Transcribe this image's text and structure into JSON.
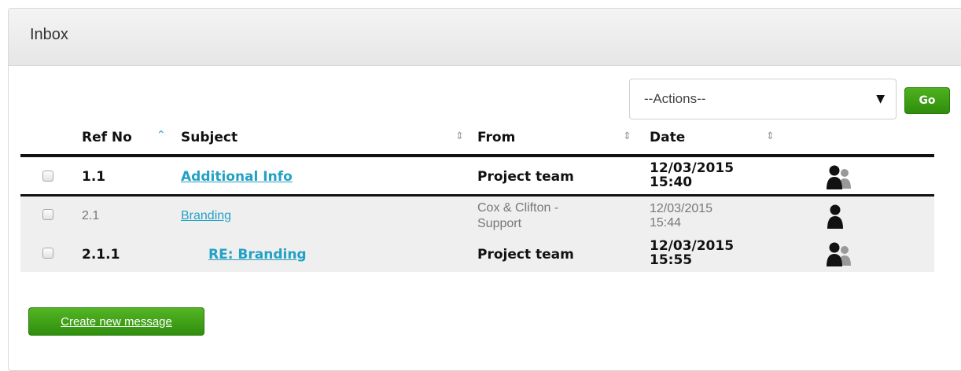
{
  "panel": {
    "title": "Inbox"
  },
  "actions": {
    "selected": "--Actions--",
    "go_label": "Go"
  },
  "table": {
    "columns": [
      {
        "label": "Ref No",
        "sortable": true,
        "sort": "asc"
      },
      {
        "label": "Subject",
        "sortable": true
      },
      {
        "label": "From",
        "sortable": true
      },
      {
        "label": "Date",
        "sortable": true
      }
    ],
    "rows": [
      {
        "ref": "1.1",
        "subject": "Additional Info",
        "from": "Project team",
        "date": "12/03/2015",
        "time": "15:40",
        "unread": true,
        "icon": "group-users-icon"
      },
      {
        "ref": "2.1",
        "subject": "Branding",
        "from_line1": "Cox & Clifton -",
        "from_line2": "Support",
        "date": "12/03/2015",
        "time": "15:44",
        "unread": false,
        "icon": "single-user-icon"
      },
      {
        "ref": "2.1.1",
        "subject": "RE: Branding",
        "from": "Project team",
        "date": "12/03/2015",
        "time": "15:55",
        "unread": true,
        "icon": "group-users-icon"
      }
    ]
  },
  "footer": {
    "create_label": "Create new message"
  },
  "colors": {
    "accent_link": "#22a1c4",
    "button_green": "#3da015",
    "sort_active": "#2aa6c9"
  }
}
